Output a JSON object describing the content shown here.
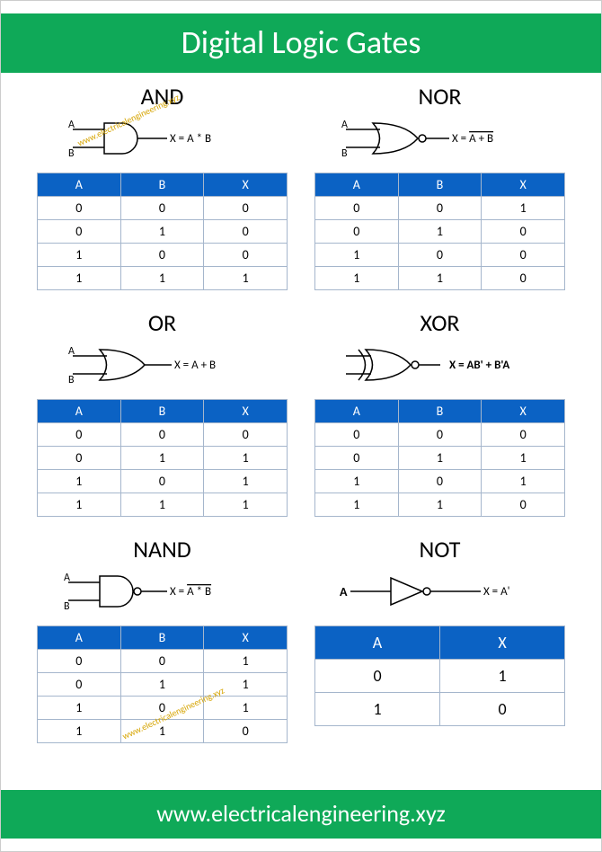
{
  "header": "Digital Logic Gates",
  "footer": "www.electricalengineering.xyz",
  "watermark": "www.electricalengineering.xyz",
  "gates": {
    "and": {
      "title": "AND",
      "inputs": [
        "A",
        "B"
      ],
      "eqn_prefix": "X = ",
      "eqn_core": "A * B",
      "headers": [
        "A",
        "B",
        "X"
      ],
      "rows": [
        [
          "0",
          "0",
          "0"
        ],
        [
          "0",
          "1",
          "0"
        ],
        [
          "1",
          "0",
          "0"
        ],
        [
          "1",
          "1",
          "1"
        ]
      ]
    },
    "nor": {
      "title": "NOR",
      "inputs": [
        "A",
        "B"
      ],
      "eqn_prefix": "X = ",
      "eqn_core": "A + B",
      "headers": [
        "A",
        "B",
        "X"
      ],
      "rows": [
        [
          "0",
          "0",
          "1"
        ],
        [
          "0",
          "1",
          "0"
        ],
        [
          "1",
          "0",
          "0"
        ],
        [
          "1",
          "1",
          "0"
        ]
      ]
    },
    "or": {
      "title": "OR",
      "inputs": [
        "A",
        "B"
      ],
      "eqn_prefix": "X = ",
      "eqn_core": "A + B",
      "headers": [
        "A",
        "B",
        "X"
      ],
      "rows": [
        [
          "0",
          "0",
          "0"
        ],
        [
          "0",
          "1",
          "1"
        ],
        [
          "1",
          "0",
          "1"
        ],
        [
          "1",
          "1",
          "1"
        ]
      ]
    },
    "xor": {
      "title": "XOR",
      "eqn_prefix": "X = ",
      "eqn_core": "AB' + B'A",
      "headers": [
        "A",
        "B",
        "X"
      ],
      "rows": [
        [
          "0",
          "0",
          "0"
        ],
        [
          "0",
          "1",
          "1"
        ],
        [
          "1",
          "0",
          "1"
        ],
        [
          "1",
          "1",
          "0"
        ]
      ]
    },
    "nand": {
      "title": "NAND",
      "inputs": [
        "A",
        "B"
      ],
      "eqn_prefix": "X = ",
      "eqn_core": "A * B",
      "headers": [
        "A",
        "B",
        "X"
      ],
      "rows": [
        [
          "0",
          "0",
          "1"
        ],
        [
          "0",
          "1",
          "1"
        ],
        [
          "1",
          "0",
          "1"
        ],
        [
          "1",
          "1",
          "0"
        ]
      ]
    },
    "not": {
      "title": "NOT",
      "inputs": [
        "A"
      ],
      "eqn_prefix": "X = ",
      "eqn_core": "A'",
      "headers": [
        "A",
        "X"
      ],
      "rows": [
        [
          "0",
          "1"
        ],
        [
          "1",
          "0"
        ]
      ]
    }
  }
}
